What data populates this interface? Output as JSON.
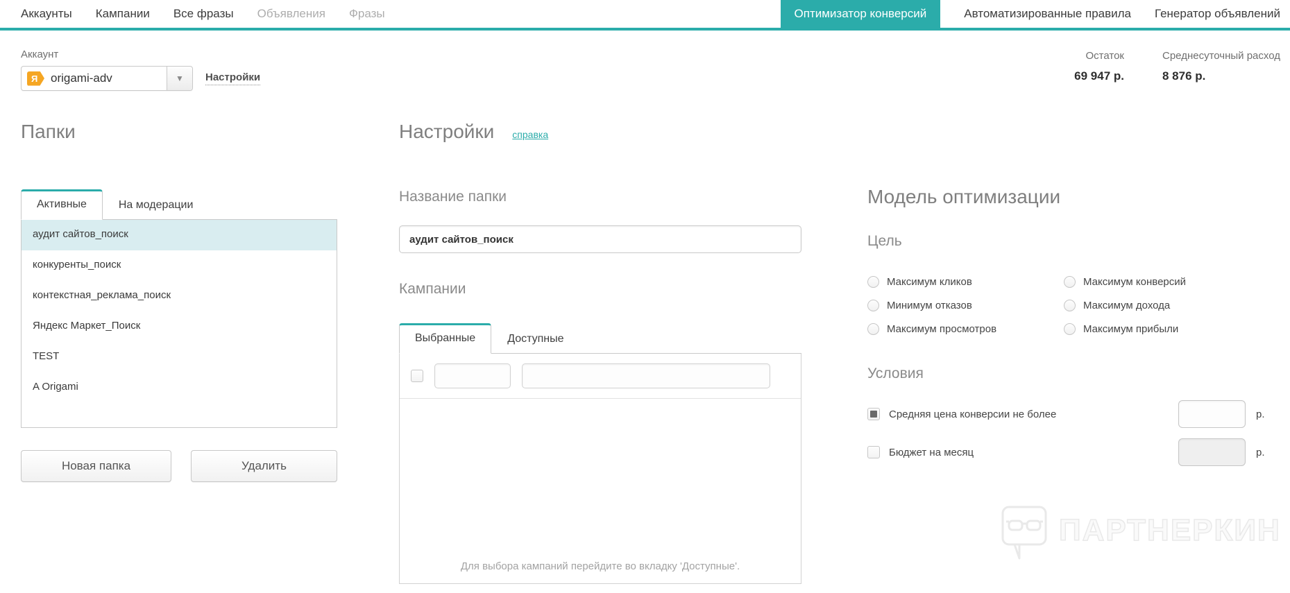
{
  "colors": {
    "accent": "#2bacaa",
    "selected_row": "#d9edf0"
  },
  "nav": {
    "items_left": [
      {
        "label": "Аккаунты",
        "disabled": false
      },
      {
        "label": "Кампании",
        "disabled": false
      },
      {
        "label": "Все фразы",
        "disabled": false
      },
      {
        "label": "Объявления",
        "disabled": true
      },
      {
        "label": "Фразы",
        "disabled": true
      }
    ],
    "items_right": [
      {
        "label": "Оптимизатор конверсий",
        "active": true
      },
      {
        "label": "Автоматизированные правила",
        "active": false
      },
      {
        "label": "Генератор объявлений",
        "active": false
      }
    ]
  },
  "account": {
    "label": "Аккаунт",
    "provider_icon": "Я",
    "selected_value": "origami-adv",
    "settings_link": "Настройки"
  },
  "stats": {
    "balance": {
      "label": "Остаток",
      "value": "69 947 р."
    },
    "avg_daily_spend": {
      "label": "Среднесуточный расход",
      "value": "8 876 р."
    }
  },
  "folders": {
    "title": "Папки",
    "tabs": [
      {
        "label": "Активные",
        "active": true
      },
      {
        "label": "На модерации",
        "active": false
      }
    ],
    "items": [
      "аудит сайтов_поиск",
      "конкуренты_поиск",
      "контекстная_реклама_поиск",
      "Яндекс Маркет_Поиск",
      "TEST",
      "A Origami"
    ],
    "selected_item": "аудит сайтов_поиск",
    "buttons": {
      "new_folder": "Новая папка",
      "delete": "Удалить"
    }
  },
  "settings": {
    "title": "Настройки",
    "help_link": "справка",
    "folder_name": {
      "label": "Название папки",
      "value": "аудит сайтов_поиск"
    },
    "campaigns": {
      "label": "Кампании",
      "tabs": [
        {
          "label": "Выбранные",
          "active": true
        },
        {
          "label": "Доступные",
          "active": false
        }
      ],
      "filter": {
        "checkbox_checked": false,
        "id_value": "",
        "name_value": ""
      },
      "empty_hint": "Для выбора кампаний перейдите во вкладку 'Доступные'."
    }
  },
  "optimization": {
    "title": "Модель оптимизации",
    "goal": {
      "label": "Цель",
      "options": [
        "Максимум кликов",
        "Максимум конверсий",
        "Минимум отказов",
        "Максимум дохода",
        "Максимум просмотров",
        "Максимум прибыли"
      ],
      "selected": null
    },
    "conditions": {
      "label": "Условия",
      "rows": [
        {
          "label": "Средняя цена конверсии не более",
          "checked": true,
          "value": "",
          "currency": "р."
        },
        {
          "label": "Бюджет на месяц",
          "checked": false,
          "value": "",
          "currency": "р."
        }
      ]
    }
  },
  "watermark": {
    "text": "ПАРТНЕРКИН"
  }
}
